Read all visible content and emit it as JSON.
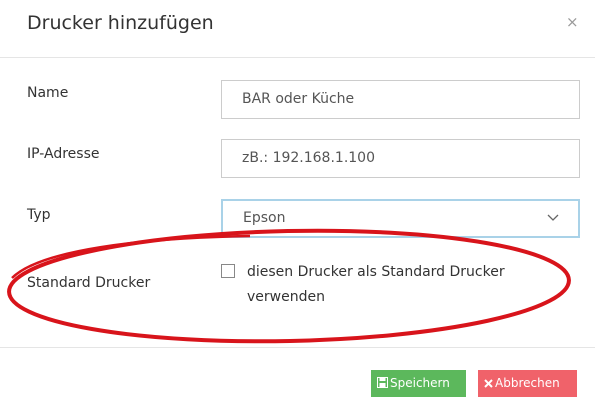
{
  "dialog": {
    "title": "Drucker hinzufügen",
    "close_symbol": "×"
  },
  "form": {
    "name_label": "Name",
    "name_value": "BAR oder Küche",
    "ip_label": "IP-Adresse",
    "ip_value": "zB.: 192.168.1.100",
    "type_label": "Typ",
    "type_value": "Epson",
    "default_label": "Standard Drucker",
    "default_checkbox_text": "diesen Drucker als Standard Drucker verwenden",
    "default_checked": false
  },
  "footer": {
    "save_label": "Speichern",
    "cancel_label": "Abbrechen"
  },
  "colors": {
    "save_button": "#5cb85c",
    "cancel_button": "#f0626a",
    "annotation_ellipse": "#d8141b",
    "focus_border": "#a9d2e8"
  },
  "icons": {
    "close": "close-icon",
    "select": "chevron-down-icon",
    "save": "floppy-disk-icon",
    "cancel": "x-icon"
  }
}
